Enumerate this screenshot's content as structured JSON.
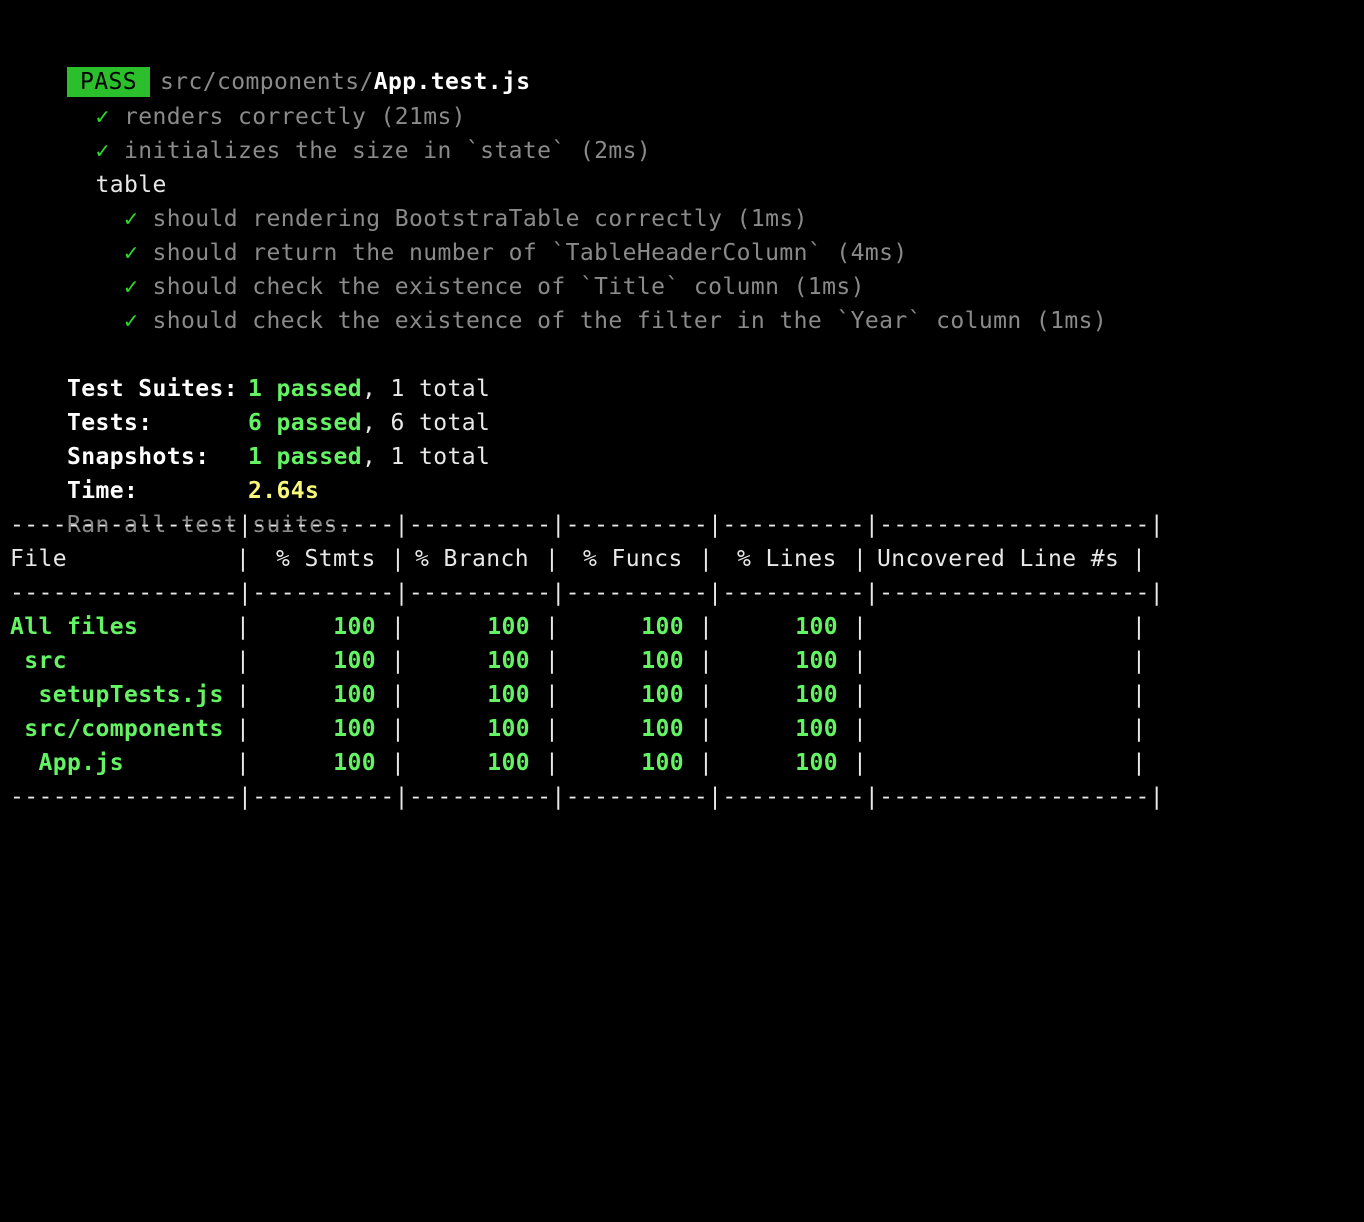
{
  "header": {
    "badge": "PASS",
    "path_dir": "src/components/",
    "path_file": "App.test.js"
  },
  "tests": {
    "check": "✓",
    "top": [
      "renders correctly (21ms)",
      "initializes the size in `state` (2ms)"
    ],
    "group_name": "table",
    "group": [
      "should rendering BootstraTable correctly (1ms)",
      "should return the number of `TableHeaderColumn` (4ms)",
      "should check the existence of `Title` column (1ms)",
      "should check the existence of the filter in the `Year` column (1ms)"
    ]
  },
  "summary": {
    "suites_label": "Test Suites:",
    "suites_passed": "1 passed",
    "suites_total": ", 1 total",
    "tests_label": "Tests:",
    "tests_passed": "6 passed",
    "tests_total": ", 6 total",
    "snapshots_label": "Snapshots:",
    "snapshots_passed": "1 passed",
    "snapshots_total": ", 1 total",
    "time_label": "Time:",
    "time_value": "2.64s",
    "ran_all": "Ran all test suites."
  },
  "coverage": {
    "rule": "----------------|----------|----------|----------|----------|-------------------|",
    "headers": [
      "File",
      "% Stmts",
      "% Branch",
      "% Funcs",
      "% Lines",
      "Uncovered Line #s"
    ],
    "rows": [
      {
        "file": "All files",
        "stmts": "100",
        "branch": "100",
        "funcs": "100",
        "lines": "100",
        "uncovered": ""
      },
      {
        "file": " src",
        "stmts": "100",
        "branch": "100",
        "funcs": "100",
        "lines": "100",
        "uncovered": ""
      },
      {
        "file": "  setupTests.js",
        "stmts": "100",
        "branch": "100",
        "funcs": "100",
        "lines": "100",
        "uncovered": ""
      },
      {
        "file": " src/components",
        "stmts": "100",
        "branch": "100",
        "funcs": "100",
        "lines": "100",
        "uncovered": ""
      },
      {
        "file": "  App.js",
        "stmts": "100",
        "branch": "100",
        "funcs": "100",
        "lines": "100",
        "uncovered": ""
      }
    ]
  },
  "colors": {
    "background": "#000000",
    "pass_badge": "#2bbf2b",
    "check": "#2ad92a",
    "passed": "#63f363",
    "time": "#f8f87a",
    "dim": "#8a8a8a"
  }
}
